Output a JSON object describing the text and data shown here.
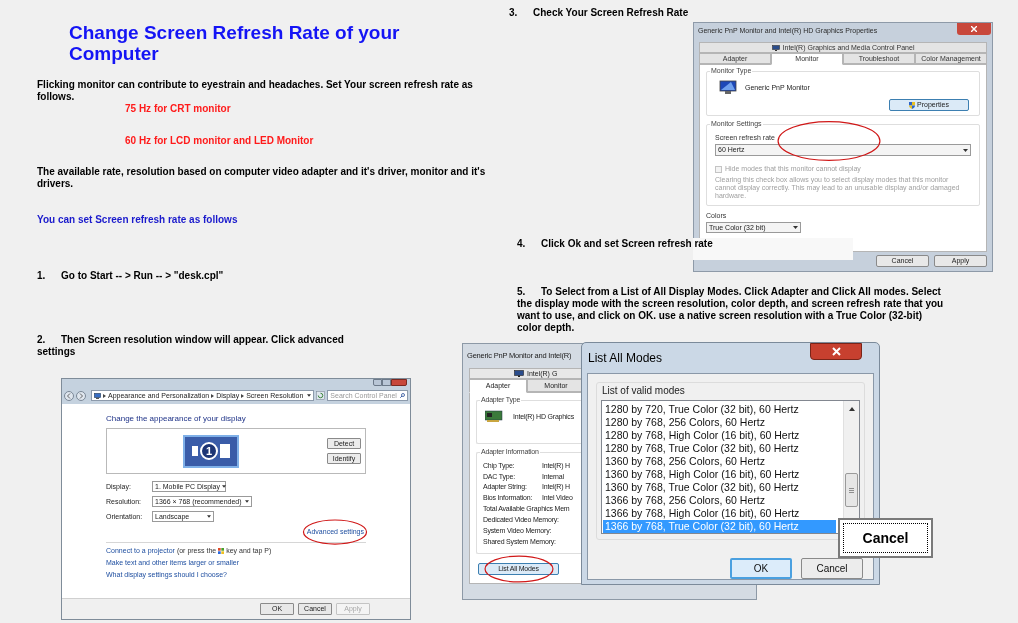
{
  "document": {
    "title": "Change Screen Refresh Rate of your Computer",
    "intro": "Flicking monitor can contribute to eyestrain and headaches. Set Your screen refresh rate as follows.",
    "rates": [
      "75 Hz for CRT monitor",
      "60 Hz for LCD monitor and LED Monitor"
    ],
    "note": "The available rate, resolution based on computer video adapter and it's driver, monitor and it's drivers.",
    "lead": "You can set Screen refresh rate as follows",
    "steps": [
      {
        "number": "1.",
        "text": "Go to Start -- > Run -- > \"desk.cpl\""
      },
      {
        "number": "2.",
        "text": "Then Screen resolution window will appear. Click advanced settings"
      },
      {
        "number": "3.",
        "text": "Check Your Screen Refresh Rate"
      },
      {
        "number": "4.",
        "text": "Click Ok and set Screen refresh rate"
      },
      {
        "number": "5.",
        "text": "To Select from a List of All Display Modes. Click Adapter and Click All modes. Select the display mode with the screen resolution, color depth, and screen refresh rate that you want to use, and click on OK. use a native screen resolution with a True Color (32-bit) color depth."
      }
    ]
  },
  "monitor_properties_dialog": {
    "title": "Generic PnP Monitor and Intel(R) HD Graphics Properties",
    "top_tab": "Intel(R) Graphics and Media Control Panel",
    "tabs": [
      {
        "label": "Adapter",
        "selected": false
      },
      {
        "label": "Monitor",
        "selected": true
      },
      {
        "label": "Troubleshoot",
        "selected": false
      },
      {
        "label": "Color Management",
        "selected": false
      }
    ],
    "monitor_type": {
      "label": "Monitor Type",
      "name": "Generic PnP Monitor",
      "button": "Properties"
    },
    "monitor_settings": {
      "label": "Monitor Settings",
      "refresh_label": "Screen refresh rate",
      "refresh_value": "60 Hertz",
      "hide_modes": {
        "label": "Hide modes that this monitor cannot display",
        "checked": false,
        "disabled": true
      },
      "warning": "Clearing this check box allows you to select display modes that this monitor cannot display correctly. This may lead to an unusable display and/or damaged hardware."
    },
    "colors": {
      "label": "Colors",
      "value": "True Color (32 bit)"
    },
    "buttons": [
      "Cancel",
      "Apply"
    ]
  },
  "screen_resolution_window": {
    "breadcrumb": [
      "Appearance and Personalization",
      "Display",
      "Screen Resolution"
    ],
    "search_placeholder": "Search Control Panel",
    "heading": "Change the appearance of your display",
    "monitor_number": "1",
    "side_buttons": [
      "Detect",
      "Identify"
    ],
    "settings": [
      {
        "label": "Display:",
        "value": "1. Mobile PC Display"
      },
      {
        "label": "Resolution:",
        "value": "1366 × 768 (recommended)"
      },
      {
        "label": "Orientation:",
        "value": "Landscape"
      }
    ],
    "advanced_link": "Advanced settings",
    "projector": {
      "link": "Connect to a projector",
      "before_key": "(or press the",
      "after_key": "key and tap P)"
    },
    "links": [
      "Make text and other items larger or smaller",
      "What display settings should I choose?"
    ],
    "buttons": [
      {
        "label": "OK",
        "disabled": false
      },
      {
        "label": "Cancel",
        "disabled": false
      },
      {
        "label": "Apply",
        "disabled": true
      }
    ]
  },
  "adapter_properties_dialog": {
    "title": "Generic PnP Monitor and Intel(R)",
    "top_tab": "Intel(R) G",
    "tabs": [
      {
        "label": "Adapter",
        "selected": true
      },
      {
        "label": "Monitor",
        "selected": false
      }
    ],
    "adapter_type": {
      "label": "Adapter Type",
      "name": "Intel(R) HD Graphics"
    },
    "adapter_info": {
      "label": "Adapter Information",
      "rows": [
        {
          "label": "Chip Type:",
          "value": "Intel(R) H"
        },
        {
          "label": "DAC Type:",
          "value": "Internal"
        },
        {
          "label": "Adapter String:",
          "value": "Intel(R) H"
        },
        {
          "label": "Bios Information:",
          "value": "Intel Video"
        }
      ],
      "memory": [
        "Total Available Graphics Mem",
        "Dedicated Video Memory:",
        "System Video Memory:",
        "Shared System Memory:"
      ]
    },
    "button": "List All Modes"
  },
  "list_all_modes_dialog": {
    "title": "List All Modes",
    "group": "List of valid modes",
    "modes": [
      {
        "text": "1280 by 720, True Color (32 bit), 60 Hertz",
        "selected": false
      },
      {
        "text": "1280 by 768, 256 Colors, 60 Hertz",
        "selected": false
      },
      {
        "text": "1280 by 768, High Color (16 bit), 60 Hertz",
        "selected": false
      },
      {
        "text": "1280 by 768, True Color (32 bit), 60 Hertz",
        "selected": false
      },
      {
        "text": "1360 by 768, 256 Colors, 60 Hertz",
        "selected": false
      },
      {
        "text": "1360 by 768, High Color (16 bit), 60 Hertz",
        "selected": false
      },
      {
        "text": "1360 by 768, True Color (32 bit), 60 Hertz",
        "selected": false
      },
      {
        "text": "1366 by 768, 256 Colors, 60 Hertz",
        "selected": false
      },
      {
        "text": "1366 by 768, High Color (16 bit), 60 Hertz",
        "selected": false
      },
      {
        "text": "1366 by 768, True Color (32 bit), 60 Hertz",
        "selected": true
      }
    ],
    "buttons": [
      {
        "label": "OK",
        "default": true
      },
      {
        "label": "Cancel",
        "default": false
      }
    ]
  },
  "floating_button": {
    "label": "Cancel"
  }
}
